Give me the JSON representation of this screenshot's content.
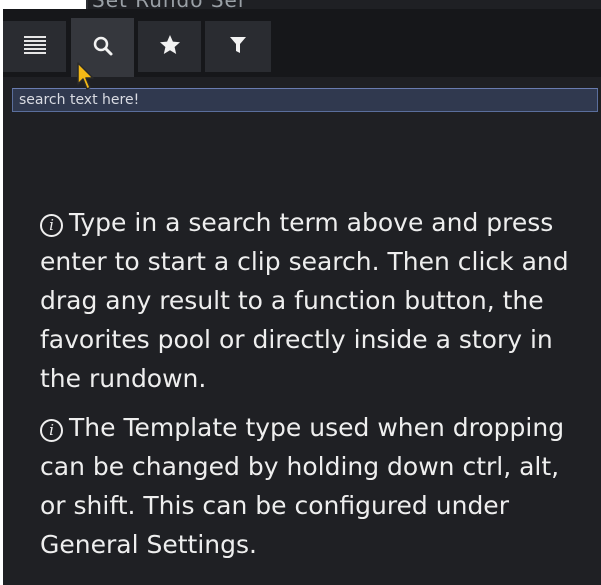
{
  "header": {
    "partial_title": "Set Rundo Sei"
  },
  "toolbar": {
    "buttons": [
      {
        "name": "list",
        "icon": "list-icon",
        "active": false
      },
      {
        "name": "search",
        "icon": "search-icon",
        "active": true
      },
      {
        "name": "favorites",
        "icon": "star-icon",
        "active": false
      },
      {
        "name": "filter",
        "icon": "filter-icon",
        "active": false
      }
    ]
  },
  "search": {
    "placeholder": "search text here!",
    "value": ""
  },
  "help": {
    "info_icon_glyph": "i",
    "paragraph_1": "Type in a search term above and press enter to start a clip search. Then click and drag any result to a function button, the favorites pool or directly inside a story in the rundown.",
    "paragraph_2": "The Template type used when dropping can be changed by holding down ctrl, alt, or shift. This can be configured under General Settings."
  },
  "colors": {
    "panel_bg": "#1f2024",
    "toolbar_bg": "#16171a",
    "button_bg": "#2a2c31",
    "active_button_bg": "#35373d",
    "search_bg": "#30394f",
    "search_border": "#5a6e9c",
    "text": "#eeeeee",
    "cursor": "#f5b915"
  }
}
